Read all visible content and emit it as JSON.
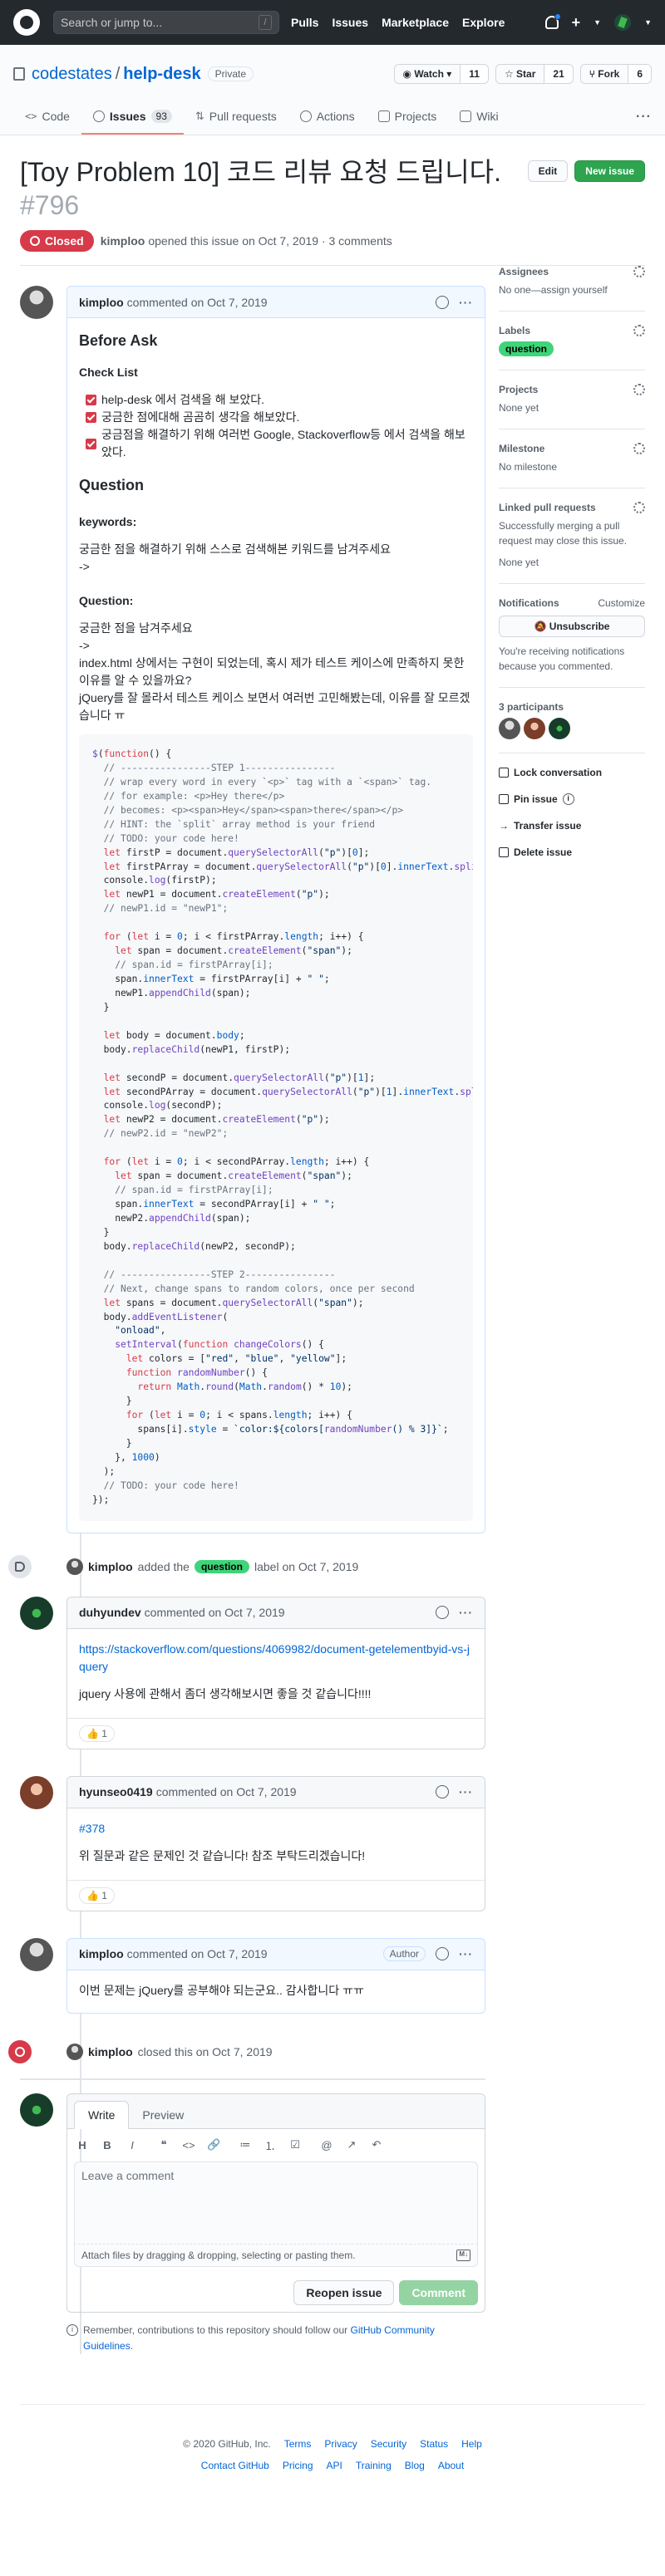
{
  "header": {
    "search_placeholder": "Search or jump to...",
    "search_key": "/",
    "nav": [
      "Pulls",
      "Issues",
      "Marketplace",
      "Explore"
    ]
  },
  "repo": {
    "owner": "codestates",
    "name": "help-desk",
    "visibility": "Private",
    "watch_label": "Watch",
    "watch_count": "11",
    "star_label": "Star",
    "star_count": "21",
    "fork_label": "Fork",
    "fork_count": "6",
    "tabs": [
      {
        "label": "Code",
        "icon": "code-icon"
      },
      {
        "label": "Issues",
        "icon": "issue-icon",
        "count": "93"
      },
      {
        "label": "Pull requests",
        "icon": "pull-request-icon"
      },
      {
        "label": "Actions",
        "icon": "play-icon"
      },
      {
        "label": "Projects",
        "icon": "project-icon"
      },
      {
        "label": "Wiki",
        "icon": "book-icon"
      }
    ]
  },
  "issue": {
    "title": "[Toy Problem 10] 코드 리뷰 요청 드립니다.",
    "number": "#796",
    "edit_label": "Edit",
    "new_issue_label": "New issue",
    "state": "Closed",
    "author": "kimploo",
    "opened_text": "opened this issue on Oct 7, 2019 · 3 comments"
  },
  "first_comment": {
    "author": "kimploo",
    "meta": "commented on Oct 7, 2019",
    "heading": "Before Ask",
    "checklist_title": "Check List",
    "checklist": [
      "help-desk 에서 검색을 해 보았다.",
      "궁금한 점에대해 곰곰히 생각을 해보았다.",
      "궁금점을 해결하기 위해 여러번 Google, Stackoverflow등 에서 검색을 해보았다."
    ],
    "question_heading": "Question",
    "keywords_title": "keywords:",
    "keywords_text": "궁금한 점을 해결하기 위해 스스로 검색해본 키워드를 남겨주세요",
    "keywords_arrow": "->",
    "question_title": "Question:",
    "question_lines": [
      "궁금한 점을 남겨주세요",
      "->",
      "index.html 상에서는 구현이 되었는데, 혹시 제가 테스트 케이스에 만족하지 못한 이유를 알 수 있을까요?",
      "jQuery를 잘 몰라서 테스트 케이스 보면서 여러번 고민해봤는데, 이유를 잘 모르겠습니다 ㅠ"
    ]
  },
  "label_event": {
    "actor": "kimploo",
    "text_before": "added the",
    "label": "question",
    "text_after": "label on Oct 7, 2019"
  },
  "comments": [
    {
      "author": "duhyundev",
      "meta": "commented on Oct 7, 2019",
      "link": "https://stackoverflow.com/questions/4069982/document-getelementbyid-vs-jquery",
      "text": "jquery 사용에 관해서 좀더 생각해보시면 좋을 것 같습니다!!!!",
      "reaction": "👍 1"
    },
    {
      "author": "hyunseo0419",
      "meta": "commented on Oct 7, 2019",
      "link": "#378",
      "text": "위 질문과 같은 문제인 것 같습니다! 참조 부탁드리겠습니다!",
      "reaction": "👍 1"
    },
    {
      "author": "kimploo",
      "meta": "commented on Oct 7, 2019",
      "badge": "Author",
      "text": "이번 문제는 jQuery를 공부해야 되는군요.. 감사합니다 ㅠㅠ"
    }
  ],
  "close_event": {
    "actor": "kimploo",
    "text": "closed this on Oct 7, 2019"
  },
  "sidebar": {
    "assignees_title": "Assignees",
    "assignees_text": "No one—assign yourself",
    "labels_title": "Labels",
    "label": "question",
    "projects_title": "Projects",
    "projects_text": "None yet",
    "milestone_title": "Milestone",
    "milestone_text": "No milestone",
    "linked_title": "Linked pull requests",
    "linked_text": "Successfully merging a pull request may close this issue.",
    "linked_none": "None yet",
    "notifications_title": "Notifications",
    "customize": "Customize",
    "unsubscribe": "Unsubscribe",
    "notif_text": "You're receiving notifications because you commented.",
    "participants_title": "3 participants",
    "actions": [
      "Lock conversation",
      "Pin issue",
      "Transfer issue",
      "Delete issue"
    ]
  },
  "form": {
    "write_tab": "Write",
    "preview_tab": "Preview",
    "toolbar": [
      "H",
      "B",
      "I",
      "❝",
      "<>",
      "🔗",
      "≔",
      "⒈",
      "☑",
      "@",
      "↗",
      "↶"
    ],
    "placeholder": "Leave a comment",
    "attach_text": "Attach files by dragging & dropping, selecting or pasting them.",
    "reopen_label": "Reopen issue",
    "comment_label": "Comment",
    "remember_text": "Remember, contributions to this repository should follow our",
    "guidelines_link": "GitHub Community Guidelines",
    "remember_end": "."
  },
  "footer": {
    "row1": [
      "© 2020 GitHub, Inc.",
      "Terms",
      "Privacy",
      "Security",
      "Status",
      "Help"
    ],
    "row2": [
      "Contact GitHub",
      "Pricing",
      "API",
      "Training",
      "Blog",
      "About"
    ]
  }
}
